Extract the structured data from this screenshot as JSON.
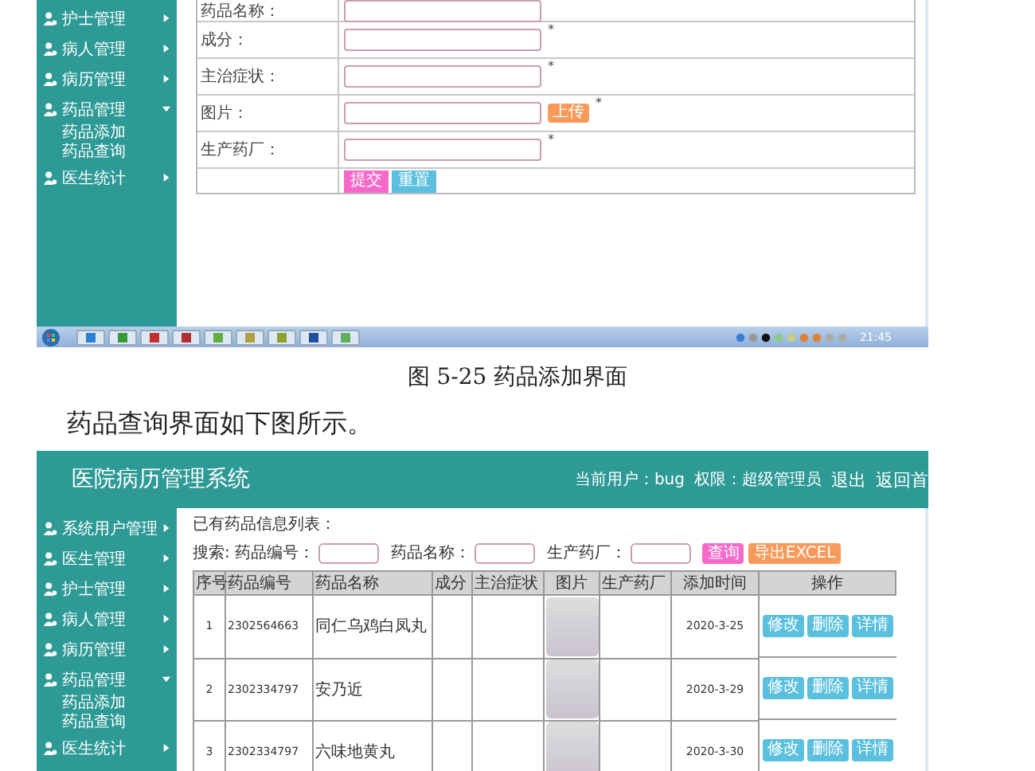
{
  "add_screen": {
    "sidebar": [
      {
        "label": "护士管理",
        "expanded": false
      },
      {
        "label": "病人管理",
        "expanded": false
      },
      {
        "label": "病历管理",
        "expanded": false
      },
      {
        "label": "药品管理",
        "expanded": true,
        "children": [
          {
            "label": "药品添加"
          },
          {
            "label": "药品查询"
          }
        ]
      },
      {
        "label": "医生统计",
        "expanded": false
      }
    ],
    "form": {
      "fields": [
        {
          "label": "药品名称：",
          "kind": "text"
        },
        {
          "label": "成分：",
          "kind": "text",
          "required_mark": "*"
        },
        {
          "label": "主治症状：",
          "kind": "text",
          "required_mark": "*"
        },
        {
          "label": "图片：",
          "kind": "upload",
          "button": "上传",
          "required_mark": "*"
        },
        {
          "label": "生产药厂：",
          "kind": "text",
          "required_mark": "*"
        }
      ],
      "buttons": [
        {
          "label": "提交",
          "kind": "submit"
        },
        {
          "label": "重置",
          "kind": "reset"
        }
      ]
    },
    "taskbar": {
      "clock": "21:45"
    }
  },
  "caption": "图 5-25 药品添加界面",
  "paragraph": "药品查询界面如下图所示。",
  "query_screen": {
    "title": "医院病历管理系统",
    "user_info": "当前用户：bug",
    "role": "权限：超级管理员",
    "links": [
      "退出",
      "返回首"
    ],
    "sidebar": [
      {
        "label": "系统用户管理",
        "expanded": false
      },
      {
        "label": "医生管理",
        "expanded": false
      },
      {
        "label": "护士管理",
        "expanded": false
      },
      {
        "label": "病人管理",
        "expanded": false
      },
      {
        "label": "病历管理",
        "expanded": false
      },
      {
        "label": "药品管理",
        "expanded": true,
        "children": [
          {
            "label": "药品添加"
          },
          {
            "label": "药品查询"
          }
        ]
      },
      {
        "label": "医生统计",
        "expanded": false
      }
    ],
    "list_title": "已有药品信息列表：",
    "search": {
      "label": "搜索:",
      "fields": [
        {
          "label": "药品编号："
        },
        {
          "label": "药品名称："
        },
        {
          "label": "生产药厂："
        }
      ],
      "buttons": [
        {
          "label": "查询",
          "kind": "search"
        },
        {
          "label": "导出EXCEL",
          "kind": "export"
        }
      ]
    },
    "table": {
      "columns": [
        "序号",
        "药品编号",
        "药品名称",
        "成分",
        "主治症状",
        "图片",
        "生产药厂",
        "添加时间",
        "操作"
      ],
      "rows": [
        {
          "cells": [
            "1",
            "2302564663",
            "同仁乌鸡白凤丸",
            "",
            "",
            "",
            "",
            "2020-3-25"
          ],
          "actions": [
            "修改",
            "删除",
            "详情"
          ]
        },
        {
          "cells": [
            "2",
            "2302334797",
            "安乃近",
            "",
            "",
            "",
            "",
            "2020-3-29"
          ],
          "actions": [
            "修改",
            "删除",
            "详情"
          ]
        },
        {
          "cells": [
            "3",
            "2302334797",
            "六味地黄丸",
            "",
            "",
            "",
            "",
            "2020-3-30"
          ],
          "actions": [
            "修改",
            "删除",
            "详情"
          ]
        }
      ]
    }
  }
}
